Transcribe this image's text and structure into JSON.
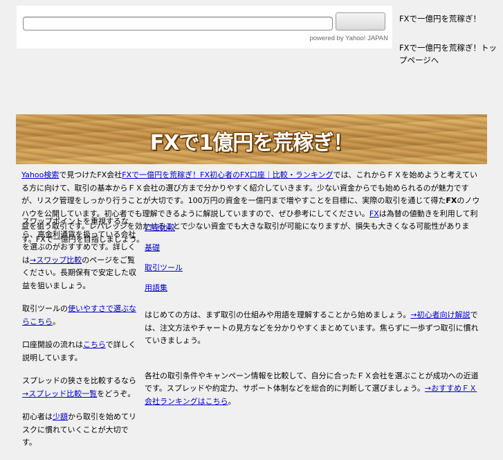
{
  "search": {
    "input_value": "",
    "button_label": "",
    "powered_by": "powered by Yahoo! JAPAN"
  },
  "side_links": [
    "FXで一億円を荒稼ぎ！",
    "FXで一億円を荒稼ぎ！トップページへ"
  ],
  "banner": {
    "title": "FXで1億円を荒稼ぎ！"
  },
  "intro": {
    "link1": "Yahoo検索",
    "text1": "で見つけたFX会社",
    "link2": "FXで一億円を荒稼ぎ！FX初心者のFX口座｜比較・ランキング",
    "text2": "では、これからＦＸを始めようと考えている方に向けて、取引の基本からＦＸ会社の選び方まで分かりやすく紹介していきます。少ない資金からでも始められるのが魅力ですが、リスク管理をしっかり行うことが大切です。100万円の資金を一億円まで増やすことを目標に、実際の取引を通じて得た",
    "bold": "FX",
    "text3": "のノウハウを公開しています。初心者でも理解できるように解説していますので、ぜひ参考にしてください。",
    "link3": "FX",
    "text4": "は為替の値動きを利用して利益を狙う取引です。レバレッジを効かせることで少ない資金でも大きな取引が可能になりますが、損失も大きくなる可能性があります。FXで一億円を目指しましょう。"
  },
  "left_col": {
    "p1_text": "スワップポイントを重視するなら、高金利通貨を扱っている会社を選ぶのがおすすめです。詳しくは",
    "p1_link": "→スワップ比較",
    "p1_tail": "のページをご覧ください。長期保有で安定した収益を狙いましょう。",
    "p2_text": "取引ツールの",
    "p2_link": "使いやすさで選ぶならこちら",
    "p2_tail": "。",
    "p3_text": "口座開設の流れは",
    "p3_link": "こちら",
    "p3_tail": "で詳しく説明しています。",
    "p4_text": "スプレッドの狭さを比較するなら",
    "p4_link": "→スプレッド比較",
    "p4_link2": "一覧",
    "p4_tail": "をどうぞ。",
    "p5_text": "初心者は",
    "p5_link": "少額",
    "p5_tail": "から取引を始めてリスクに慣れていくことが大切です。"
  },
  "nav": [
    "口座比較",
    "基礎",
    "取引ツール",
    "用語集"
  ],
  "main": {
    "p1_text": "はじめての方は、まず取引の仕組みや用語を理解することから始めましょう。",
    "p1_link": "→初心者向け解説",
    "p1_tail": "では、注文方法やチャートの見方などを分かりやすくまとめています。焦らずに一歩ずつ取引に慣れていきましょう。",
    "p2_text": "各社の取引条件やキャンペーン情報を比較して、自分に合ったＦＸ会社を選ぶことが成功への近道です。スプレッドや約定力、サポート体制などを総合的に判断して選びましょう。",
    "p2_link": "→おすすめＦＸ会社ランキングはこちら",
    "p2_tail": "。"
  }
}
